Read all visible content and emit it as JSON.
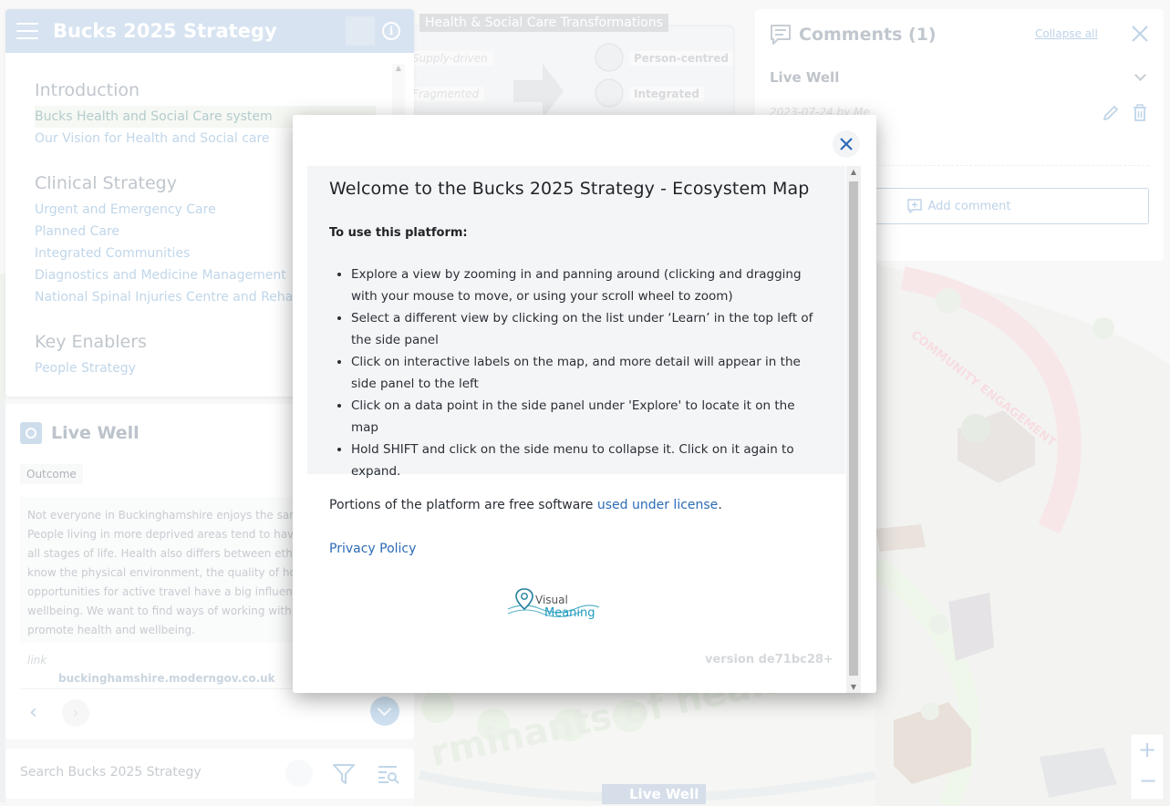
{
  "app": {
    "title": "Bucks 2025 Strategy"
  },
  "nav": {
    "sections": [
      {
        "heading": "Introduction",
        "items": [
          "Bucks Health and Social Care system",
          "Our Vision for Health and Social care"
        ]
      },
      {
        "heading": "Clinical Strategy",
        "items": [
          "Urgent and Emergency Care",
          "Planned Care",
          "Integrated Communities",
          "Diagnostics and Medicine Management",
          "National Spinal Injuries Centre and Rehabili"
        ]
      },
      {
        "heading": "Key Enablers",
        "items": [
          "People Strategy"
        ]
      }
    ],
    "active_item": "Bucks Health and Social Care system"
  },
  "live_panel": {
    "title": "Live Well",
    "tag": "Outcome",
    "text_lines": [
      "Not everyone in Buckinghamshire enjoys the same",
      "People living in more deprived areas tend to have p",
      "all stages of life. Health also differs between ethnic",
      "know the physical environment, the quality of hous",
      "opportunities for active travel have a big influence o",
      "wellbeing. We want to find ways of working with co",
      "promote health and wellbeing."
    ],
    "link_label": "link",
    "link_url": "buckinghamshire.moderngov.co.uk"
  },
  "search": {
    "placeholder": "Search Bucks 2025 Strategy"
  },
  "comments": {
    "title": "Comments (1)",
    "collapse_all": "Collapse all",
    "group": "Live Well",
    "date": "2023-07-24 by Me",
    "add_comment": "Add comment"
  },
  "map": {
    "transform_title": "Health & Social Care Transformations",
    "left_labels": [
      "Supply-driven",
      "Fragmented"
    ],
    "right_labels": [
      "Person-centred",
      "Integrated"
    ],
    "arc_text": "COMMUNITY ENGAGEMENT",
    "determinants_text": "rminants of health",
    "live_well_badge": "Live Well"
  },
  "modal": {
    "title": "Welcome to the Bucks 2025 Strategy - Ecosystem Map",
    "usage_heading": "To use this platform:",
    "usage_items": [
      "Explore a view by zooming in and panning around (clicking and dragging with your mouse to move, or using your scroll wheel to zoom)",
      "Select a different view by clicking on the list under ‘Learn’ in the top left of the side panel",
      "Click on interactive labels on the map, and more detail will appear in the side panel to the left",
      "Click on a data point in the side panel under 'Explore' to locate it on the map",
      "Hold SHIFT and click on the side menu to collapse it. Click on it again to expand."
    ],
    "license_prefix": "Portions of the platform are free software ",
    "license_link": "used under license",
    "license_suffix": ".",
    "privacy": "Privacy Policy",
    "logo_line1": "Visual",
    "logo_line2": "Meaning",
    "version": "version de71bc28+"
  },
  "colors": {
    "header_blue": "#b7cde6",
    "link_blue": "#2c6bb5",
    "accent_light_blue": "#8db5d8"
  }
}
